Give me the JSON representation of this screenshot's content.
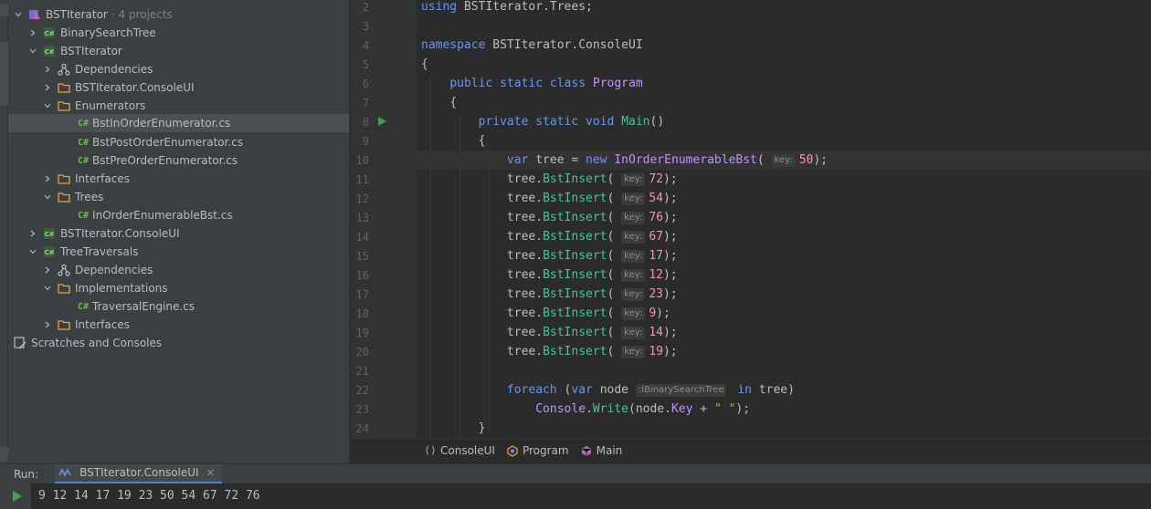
{
  "solution": {
    "name": "BSTIterator",
    "subtitle": "· 4 projects"
  },
  "tree": [
    {
      "label": "BinarySearchTree",
      "icon": "csharp-project-icon"
    },
    {
      "label": "BSTIterator",
      "icon": "csharp-project-icon"
    },
    {
      "label": "Dependencies",
      "icon": "dependencies-icon"
    },
    {
      "label": "BSTIterator.ConsoleUI",
      "icon": "folder-icon"
    },
    {
      "label": "Enumerators",
      "icon": "folder-icon"
    },
    {
      "label": "BstInOrderEnumerator.cs",
      "icon": "csharp-file-icon"
    },
    {
      "label": "BstPostOrderEnumerator.cs",
      "icon": "csharp-file-icon"
    },
    {
      "label": "BstPreOrderEnumerator.cs",
      "icon": "csharp-file-icon"
    },
    {
      "label": "Interfaces",
      "icon": "folder-icon"
    },
    {
      "label": "Trees",
      "icon": "folder-icon"
    },
    {
      "label": "InOrderEnumerableBst.cs",
      "icon": "csharp-file-icon"
    },
    {
      "label": "BSTIterator.ConsoleUI",
      "icon": "csharp-project-icon"
    },
    {
      "label": "TreeTraversals",
      "icon": "csharp-project-icon"
    },
    {
      "label": "Dependencies",
      "icon": "dependencies-icon"
    },
    {
      "label": "Implementations",
      "icon": "folder-icon"
    },
    {
      "label": "TraversalEngine.cs",
      "icon": "csharp-file-icon"
    },
    {
      "label": "Interfaces",
      "icon": "folder-icon"
    },
    {
      "label": "Scratches and Consoles",
      "icon": "scratches-icon"
    }
  ],
  "cs_glyph": "C#",
  "editor": {
    "line_numbers": [
      "2",
      "3",
      "4",
      "5",
      "6",
      "7",
      "8",
      "9",
      "10",
      "11",
      "12",
      "13",
      "14",
      "15",
      "16",
      "17",
      "18",
      "19",
      "20",
      "21",
      "22",
      "23",
      "24"
    ],
    "hint_key": "key:",
    "hint_type": ":IBinarySearchTree",
    "tokens": {
      "using": "using",
      "using_ns": "BSTIterator.Trees;",
      "namespace": "namespace",
      "namespace_name": "BSTIterator.ConsoleUI",
      "brace_open": "{",
      "brace_close": "}",
      "public": "public",
      "static": "static",
      "class": "class",
      "class_name": "Program",
      "private": "private",
      "void": "void",
      "main": "Main",
      "parens": "()",
      "var": "var",
      "tree_var": "tree",
      "eq": "=",
      "new": "new",
      "ctor": "InOrderEnumerableBst",
      "open_paren": "(",
      "close_stmt": ");",
      "tree_dot": "tree.",
      "insert": "BstInsert",
      "foreach": "foreach",
      "paren_open_sp": "(",
      "node_var": "node",
      "in": "in",
      "tree_close": "tree)",
      "console": "Console",
      "dot": ".",
      "write": "Write",
      "node_open": "(node.",
      "key_prop": "Key",
      "plus": "+",
      "space_str": "\" \"",
      "end": ");"
    },
    "ctor_arg": "50",
    "insert_args": [
      "72",
      "54",
      "76",
      "67",
      "17",
      "12",
      "23",
      "9",
      "14",
      "19"
    ]
  },
  "breadcrumb": [
    "ConsoleUI",
    "Program",
    "Main"
  ],
  "run": {
    "label": "Run:",
    "tab": "BSTIterator.ConsoleUI",
    "close": "✕",
    "output": "9 12 14 17 19 23 50 54 67 72 76"
  }
}
